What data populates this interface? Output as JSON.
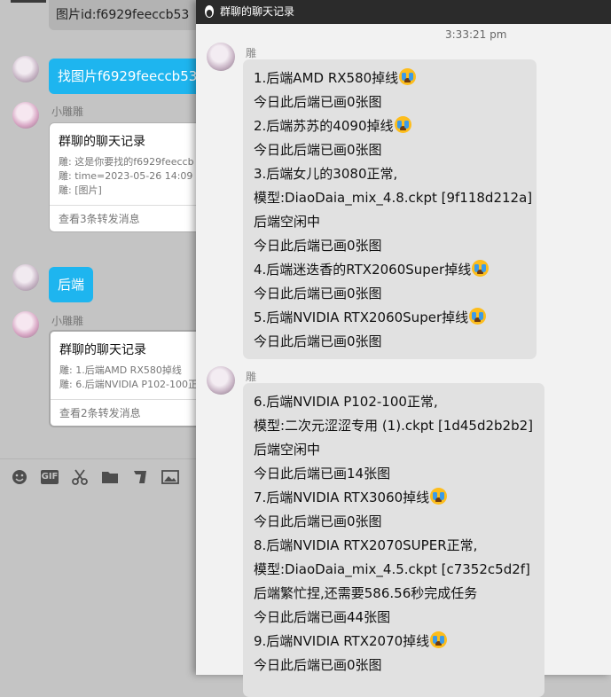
{
  "background_window": {
    "image_id_label": "图片id:f6929feeccb53",
    "find_image_label": "找图片f6929feeccb53",
    "sender_name": "小雕雕",
    "card1": {
      "title": "群聊的聊天记录",
      "lines": [
        "雕: 这是你要找的f6929feeccb",
        "雕: time=2023-05-26 14:09",
        "雕: [图片]"
      ],
      "footer": "查看3条转发消息"
    },
    "backend_label": "后端",
    "card2": {
      "title": "群聊的聊天记录",
      "lines": [
        "雕: 1.后端AMD RX580掉线",
        "雕: 6.后端NVIDIA P102-100正"
      ],
      "footer": "查看2条转发消息"
    },
    "toolbar": [
      "emoji-icon",
      "gif-icon",
      "scissors-icon",
      "folder-icon",
      "quote-icon",
      "image-icon"
    ],
    "gif_label": "GIF"
  },
  "record_window": {
    "title": "群聊的聊天记录",
    "timestamp": "3:33:21 pm",
    "messages": [
      {
        "sender": "雕",
        "lines": [
          "1.后端AMD RX580掉线",
          "今日此后端已画0张图",
          "2.后端苏苏的4090掉线",
          "今日此后端已画0张图",
          "3.后端女儿的3080正常,",
          "模型:DiaoDaia_mix_4.8.ckpt [9f118d212a]",
          "后端空闲中",
          "今日此后端已画0张图",
          "4.后端迷迭香的RTX2060Super掉线",
          "今日此后端已画0张图",
          "5.后端NVIDIA RTX2060Super掉线",
          "今日此后端已画0张图"
        ]
      },
      {
        "sender": "雕",
        "lines": [
          "6.后端NVIDIA P102-100正常,",
          "模型:二次元涩涩专用 (1).ckpt [1d45d2b2b2]",
          "后端空闲中",
          "今日此后端已画14张图",
          "7.后端NVIDIA RTX3060掉线",
          "今日此后端已画0张图",
          "8.后端NVIDIA RTX2070SUPER正常,",
          "模型:DiaoDaia_mix_4.5.ckpt [c7352c5d2f]",
          "后端繁忙捏,还需要586.56秒完成任务",
          "今日此后端已画44张图",
          "9.后端NVIDIA RTX2070掉线",
          "今日此后端已画0张图"
        ]
      }
    ]
  },
  "colors": {
    "accent_blue": "#1eb5ef",
    "bubble_gray": "#e1e1e1",
    "titlebar": "#2b2b2b"
  }
}
